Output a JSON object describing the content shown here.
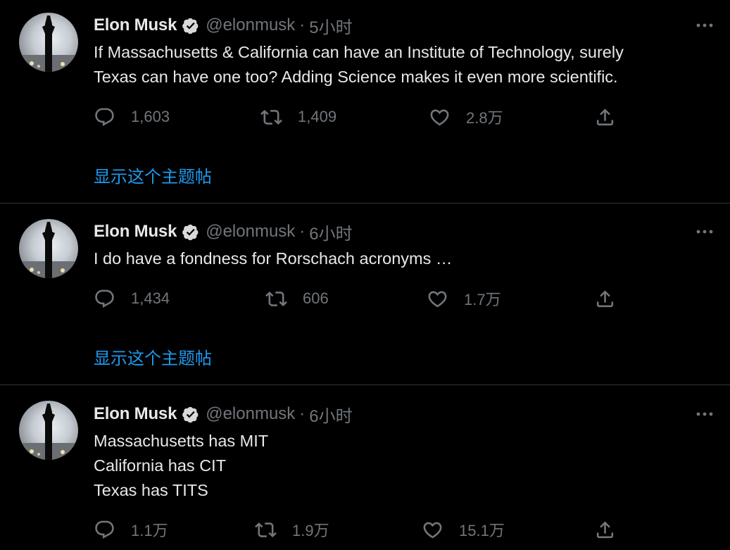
{
  "colors": {
    "background": "#000000",
    "text": "#e7e9ea",
    "muted": "#71767b",
    "link": "#1d9bf0",
    "verified": "#d9d9d9",
    "divider": "#2f3336"
  },
  "tweets": [
    {
      "author": "Elon Musk",
      "handle": "@elonmusk",
      "sep": "·",
      "time": "5小时",
      "lines": [
        "If Massachusetts & California can have an Institute of Technology, surely",
        "Texas can have one too? Adding Science makes it even more scientific."
      ],
      "replies": "1,603",
      "retweets": "1,409",
      "likes": "2.8万",
      "show_thread": "显示这个主题帖"
    },
    {
      "author": "Elon Musk",
      "handle": "@elonmusk",
      "sep": "·",
      "time": "6小时",
      "lines": [
        "I do have a fondness for Rorschach acronyms …"
      ],
      "replies": "1,434",
      "retweets": "606",
      "likes": "1.7万",
      "show_thread": "显示这个主题帖"
    },
    {
      "author": "Elon Musk",
      "handle": "@elonmusk",
      "sep": "·",
      "time": "6小时",
      "lines": [
        "Massachusetts has MIT",
        "California has CIT",
        "Texas has TITS"
      ],
      "replies": "1.1万",
      "retweets": "1.9万",
      "likes": "15.1万"
    }
  ],
  "icons": {
    "avatar": "starship-avatar",
    "verified": "verified-badge-icon",
    "more": "more-options-icon",
    "reply": "reply-icon",
    "retweet": "retweet-icon",
    "like": "heart-icon",
    "share": "share-icon"
  }
}
